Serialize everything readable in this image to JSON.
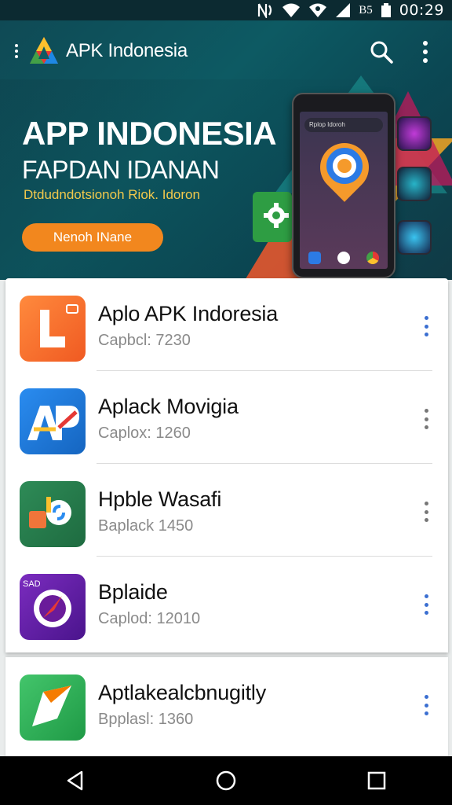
{
  "status_bar": {
    "time": "00:29",
    "icons": [
      "nfc-icon",
      "wifi-icon",
      "signal-icon",
      "signal-bars-icon",
      "lte-icon",
      "battery-icon"
    ],
    "network_label": "B5"
  },
  "app_bar": {
    "title": "APK Indonesia",
    "icons": [
      "menu-icon",
      "logo-icon",
      "search-icon",
      "more-icon"
    ]
  },
  "banner": {
    "title": "APP INDONESIA",
    "subtitle": "FAPDAN IDANAN",
    "tagline": "Dtdudndotsionoh Riok. Idoron",
    "button_label": "Nenoh INane",
    "phone_search_text": "Rplop Idoroh",
    "colors": {
      "button": "#f2871e",
      "tagline": "#f2c94c",
      "background": "#0d5a63"
    }
  },
  "apps": [
    {
      "name": "Aplo APK Indoresia",
      "meta": "Capbcl: 7230",
      "icon": "orange-app-icon",
      "kebab_color": "#3b6fd1"
    },
    {
      "name": "Aplack Movigia",
      "meta": "Caplox: 1260",
      "icon": "ap-app-icon",
      "kebab_color": "#777777"
    },
    {
      "name": "Hpble  Wasafi",
      "meta": "Baplack 1450",
      "icon": "green-share-app-icon",
      "kebab_color": "#777777"
    },
    {
      "name": "Bplaide",
      "meta": "Caplod: 12010",
      "icon": "purple-compass-app-icon",
      "kebab_color": "#3b6fd1"
    },
    {
      "name": "Aptlakealcbnugitly",
      "meta": "Bpplasl: 1360",
      "icon": "green-arrow-app-icon",
      "kebab_color": "#3b6fd1"
    }
  ],
  "nav_bar": {
    "icons": [
      "back-icon",
      "home-icon",
      "recents-icon"
    ]
  }
}
